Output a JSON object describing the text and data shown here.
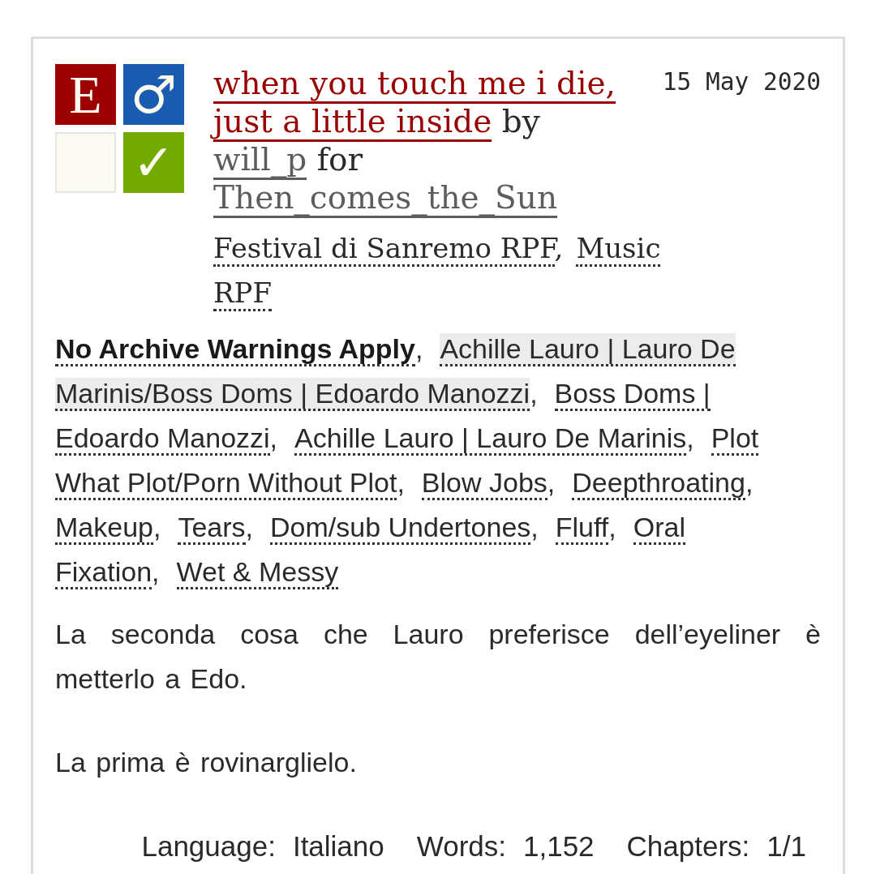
{
  "work": {
    "required_tags": [
      {
        "kind": "rating",
        "symbol": "E",
        "color": "#9c0000"
      },
      {
        "kind": "category",
        "symbol": "♂",
        "color": "#1a5cb0"
      },
      {
        "kind": "warnings",
        "color": "#fbfaf3"
      },
      {
        "kind": "complete",
        "symbol": "✓",
        "color": "#72aa00"
      }
    ],
    "title_lines": [
      "when you touch me i die,",
      "just a little inside"
    ],
    "by": "by",
    "author": "will_p",
    "for": "for",
    "recipient": "Then_comes_the_Sun",
    "date": "15 May 2020",
    "separator": ",",
    "fandoms": [
      {
        "lines": [
          "Festival di Sanremo RPF"
        ]
      },
      {
        "lines": [
          "Music",
          "RPF"
        ]
      }
    ],
    "tags": [
      {
        "kind": "warning",
        "lines": [
          "No Archive Warnings Apply"
        ],
        "highlighted": false
      },
      {
        "kind": "relationship",
        "lines": [
          "Achille Lauro | Lauro De",
          "Marinis/Boss Doms | Edoardo Manozzi"
        ],
        "highlighted": true
      },
      {
        "kind": "character",
        "lines": [
          "Boss Doms |",
          "Edoardo Manozzi"
        ],
        "highlighted": false
      },
      {
        "kind": "character",
        "lines": [
          "Achille Lauro | Lauro De Marinis"
        ],
        "highlighted": false
      },
      {
        "kind": "freeform",
        "lines": [
          "Plot",
          "What Plot/Porn Without Plot"
        ],
        "highlighted": false
      },
      {
        "kind": "freeform",
        "lines": [
          "Blow Jobs"
        ],
        "highlighted": false
      },
      {
        "kind": "freeform",
        "lines": [
          "Deepthroating"
        ],
        "highlighted": false
      },
      {
        "kind": "freeform",
        "lines": [
          "Makeup"
        ],
        "highlighted": false
      },
      {
        "kind": "freeform",
        "lines": [
          "Tears"
        ],
        "highlighted": false
      },
      {
        "kind": "freeform",
        "lines": [
          "Dom/sub Undertones"
        ],
        "highlighted": false
      },
      {
        "kind": "freeform",
        "lines": [
          "Fluff"
        ],
        "highlighted": false
      },
      {
        "kind": "freeform",
        "lines": [
          "Oral",
          "Fixation"
        ],
        "highlighted": false
      },
      {
        "kind": "freeform",
        "lines": [
          "Wet & Messy"
        ],
        "highlighted": false
      }
    ],
    "summary": [
      "La seconda cosa che Lauro preferisce dell’eyeliner è metterlo a Edo.",
      "La prima è rovinarglielo."
    ],
    "stats": [
      {
        "label": "Language:",
        "value": "Italiano"
      },
      {
        "label": "Words:",
        "value": "1,152"
      },
      {
        "label": "Chapters:",
        "value": "1/1"
      }
    ]
  }
}
